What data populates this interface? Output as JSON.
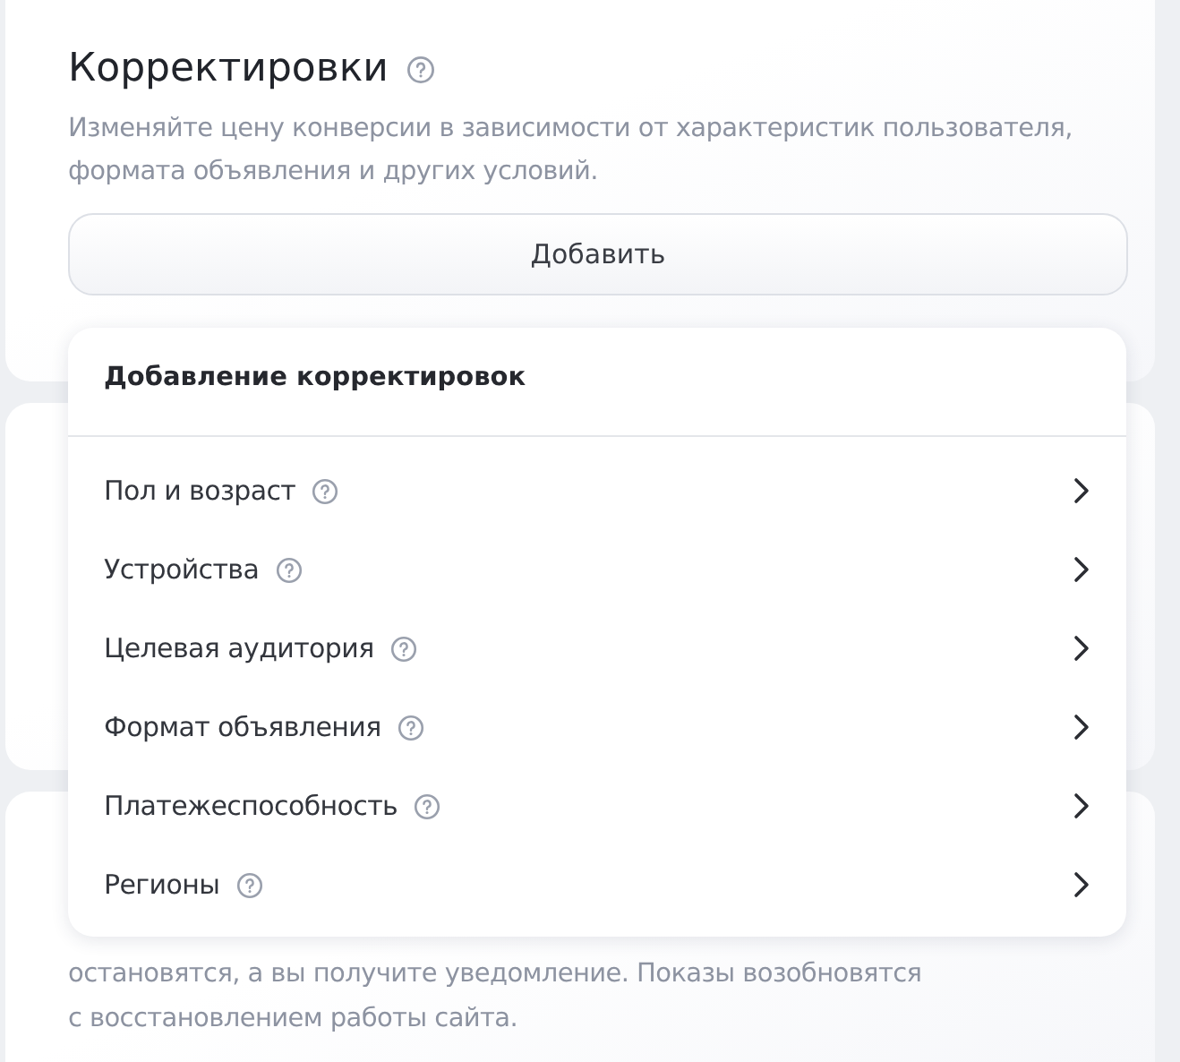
{
  "section": {
    "title": "Корректировки",
    "description": "Изменяйте цену конверсии в зависимости от характеристик пользователя, формата объявления и других условий.",
    "add_button": "Добавить"
  },
  "dropdown": {
    "title": "Добавление корректировок",
    "items": [
      {
        "label": "Пол и возраст"
      },
      {
        "label": "Устройства"
      },
      {
        "label": "Целевая аудитория"
      },
      {
        "label": "Формат объявления"
      },
      {
        "label": "Платежеспособность"
      },
      {
        "label": "Регионы"
      }
    ]
  },
  "notice": {
    "lines": [
      "остановятся, а вы получите уведомление. Показы возобновятся",
      "с восстановлением работы сайта."
    ]
  }
}
